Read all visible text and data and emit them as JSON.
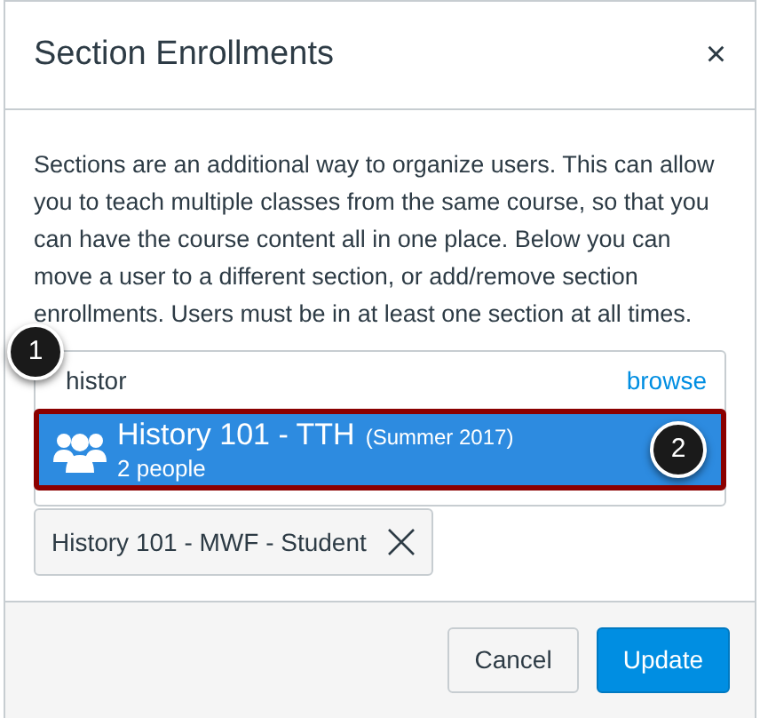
{
  "dialog": {
    "title": "Section Enrollments",
    "close": "×",
    "description": "Sections are an additional way to organize users. This can allow you to teach multiple classes from the same course, so that you can have the course content all in one place. Below you can move a user to a different section, or add/remove section enrollments. Users must be in at least one section at all times.",
    "search": {
      "value": "histor",
      "browse": "browse"
    },
    "results": [
      {
        "name": "History 101 - TTH",
        "term": "(Summer 2017)",
        "count": "2 people",
        "selected": true
      }
    ],
    "enrollments": [
      {
        "label": "History 101 - MWF - Student"
      }
    ],
    "buttons": [
      {
        "label": "Cancel",
        "kind": "secondary"
      },
      {
        "label": "Update",
        "kind": "primary"
      }
    ]
  },
  "callouts": [
    "1",
    "2"
  ]
}
